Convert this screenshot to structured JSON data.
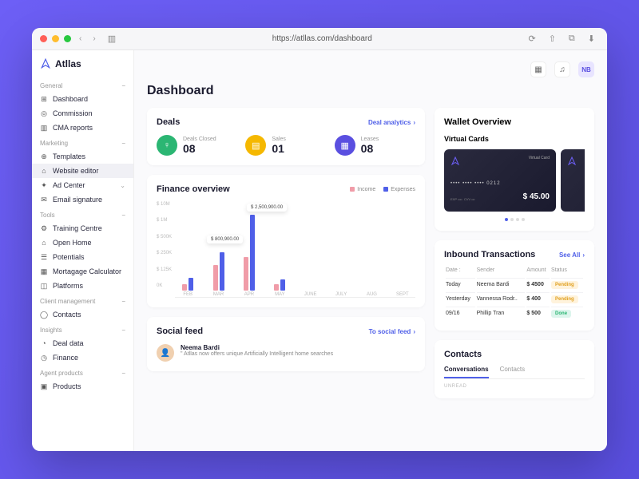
{
  "browser": {
    "url": "https://atllas.com/dashboard"
  },
  "brand": "Atllas",
  "topbar": {
    "avatar_initials": "NB"
  },
  "sidebar": {
    "groups": [
      {
        "label": "General",
        "items": [
          {
            "label": "Dashboard",
            "icon": "⊞"
          },
          {
            "label": "Commission",
            "icon": "◎"
          },
          {
            "label": "CMA reports",
            "icon": "▥"
          }
        ]
      },
      {
        "label": "Marketing",
        "items": [
          {
            "label": "Templates",
            "icon": "⊕"
          },
          {
            "label": "Website editor",
            "icon": "⌂",
            "active": true
          },
          {
            "label": "Ad Center",
            "icon": "✦",
            "expandable": true
          },
          {
            "label": "Email signature",
            "icon": "✉"
          }
        ]
      },
      {
        "label": "Tools",
        "items": [
          {
            "label": "Training Centre",
            "icon": "⚙"
          },
          {
            "label": "Open Home",
            "icon": "⌂"
          },
          {
            "label": "Potentials",
            "icon": "☰"
          },
          {
            "label": "Mortagage Calculator",
            "icon": "▦"
          },
          {
            "label": "Platforms",
            "icon": "◫"
          }
        ]
      },
      {
        "label": "Client management",
        "items": [
          {
            "label": "Contacts",
            "icon": "◯"
          }
        ]
      },
      {
        "label": "Insights",
        "items": [
          {
            "label": "Deal data",
            "icon": "◔"
          },
          {
            "label": "Finance",
            "icon": "◷"
          }
        ]
      },
      {
        "label": "Agent products",
        "items": [
          {
            "label": "Products",
            "icon": "▣"
          }
        ]
      }
    ]
  },
  "page": {
    "title": "Dashboard"
  },
  "deals": {
    "title": "Deals",
    "link": "Deal analytics",
    "stats": [
      {
        "label": "Deals Closed",
        "value": "08",
        "color": "green",
        "icon": "♀"
      },
      {
        "label": "Sales",
        "value": "01",
        "color": "yellow",
        "icon": "▤"
      },
      {
        "label": "Leases",
        "value": "08",
        "color": "blue",
        "icon": "▦"
      }
    ]
  },
  "finance": {
    "title": "Finance overview",
    "legend": {
      "income": "Income",
      "expenses": "Expenses"
    },
    "tooltips": {
      "mar": "$ 800,900.00",
      "apr": "$ 2,500,900.00"
    }
  },
  "chart_data": {
    "type": "bar",
    "categories": [
      "FEB",
      "MAR",
      "APR",
      "MAY",
      "JUNE",
      "JULY",
      "AUG",
      "SEPT"
    ],
    "series": [
      {
        "name": "Income",
        "color": "#f09ca8",
        "values": [
          125,
          500,
          700,
          100,
          0,
          0,
          0,
          0
        ]
      },
      {
        "name": "Expenses",
        "color": "#4f5fe8",
        "values": [
          250,
          800,
          2500,
          200,
          0,
          0,
          0,
          0
        ]
      }
    ],
    "ylabel": "",
    "ylim": [
      0,
      10000
    ],
    "y_ticks": [
      "$ 10M",
      "$ 1M",
      "$ 500K",
      "$ 250K",
      "$ 125K",
      "0K"
    ]
  },
  "wallet": {
    "title": "Wallet Overview",
    "vc_label": "Virtual Cards",
    "card": {
      "type": "Virtual Card",
      "number": "•••• •••• •••• 0212",
      "exp_label": "EXP",
      "exp": "••••",
      "cvv_label": "CVV",
      "cvv": "•••",
      "amount": "$ 45.00"
    }
  },
  "transactions": {
    "title": "Inbound Transactions",
    "link": "See All",
    "cols": {
      "date": "Date :",
      "sender": "Sender",
      "amount": "Amount",
      "status": "Status"
    },
    "rows": [
      {
        "date": "Today",
        "sender": "Neema Bardi",
        "amount": "$ 4500",
        "status": "Pending",
        "badge": "pending"
      },
      {
        "date": "Yesterday",
        "sender": "Vannessa Rodr..",
        "amount": "$ 400",
        "status": "Pending",
        "badge": "pending"
      },
      {
        "date": "09/16",
        "sender": "Phillip Tran",
        "amount": "$ 500",
        "status": "Done",
        "badge": "done"
      }
    ]
  },
  "social": {
    "title": "Social feed",
    "link": "To social feed",
    "post": {
      "name": "Neema Bardi",
      "text": "\" Atllas now offers unique Artificially Intelligent home searches"
    }
  },
  "contacts": {
    "title": "Contacts",
    "tabs": {
      "conversations": "Conversations",
      "contacts": "Contacts"
    },
    "unread": "UNREAD"
  }
}
